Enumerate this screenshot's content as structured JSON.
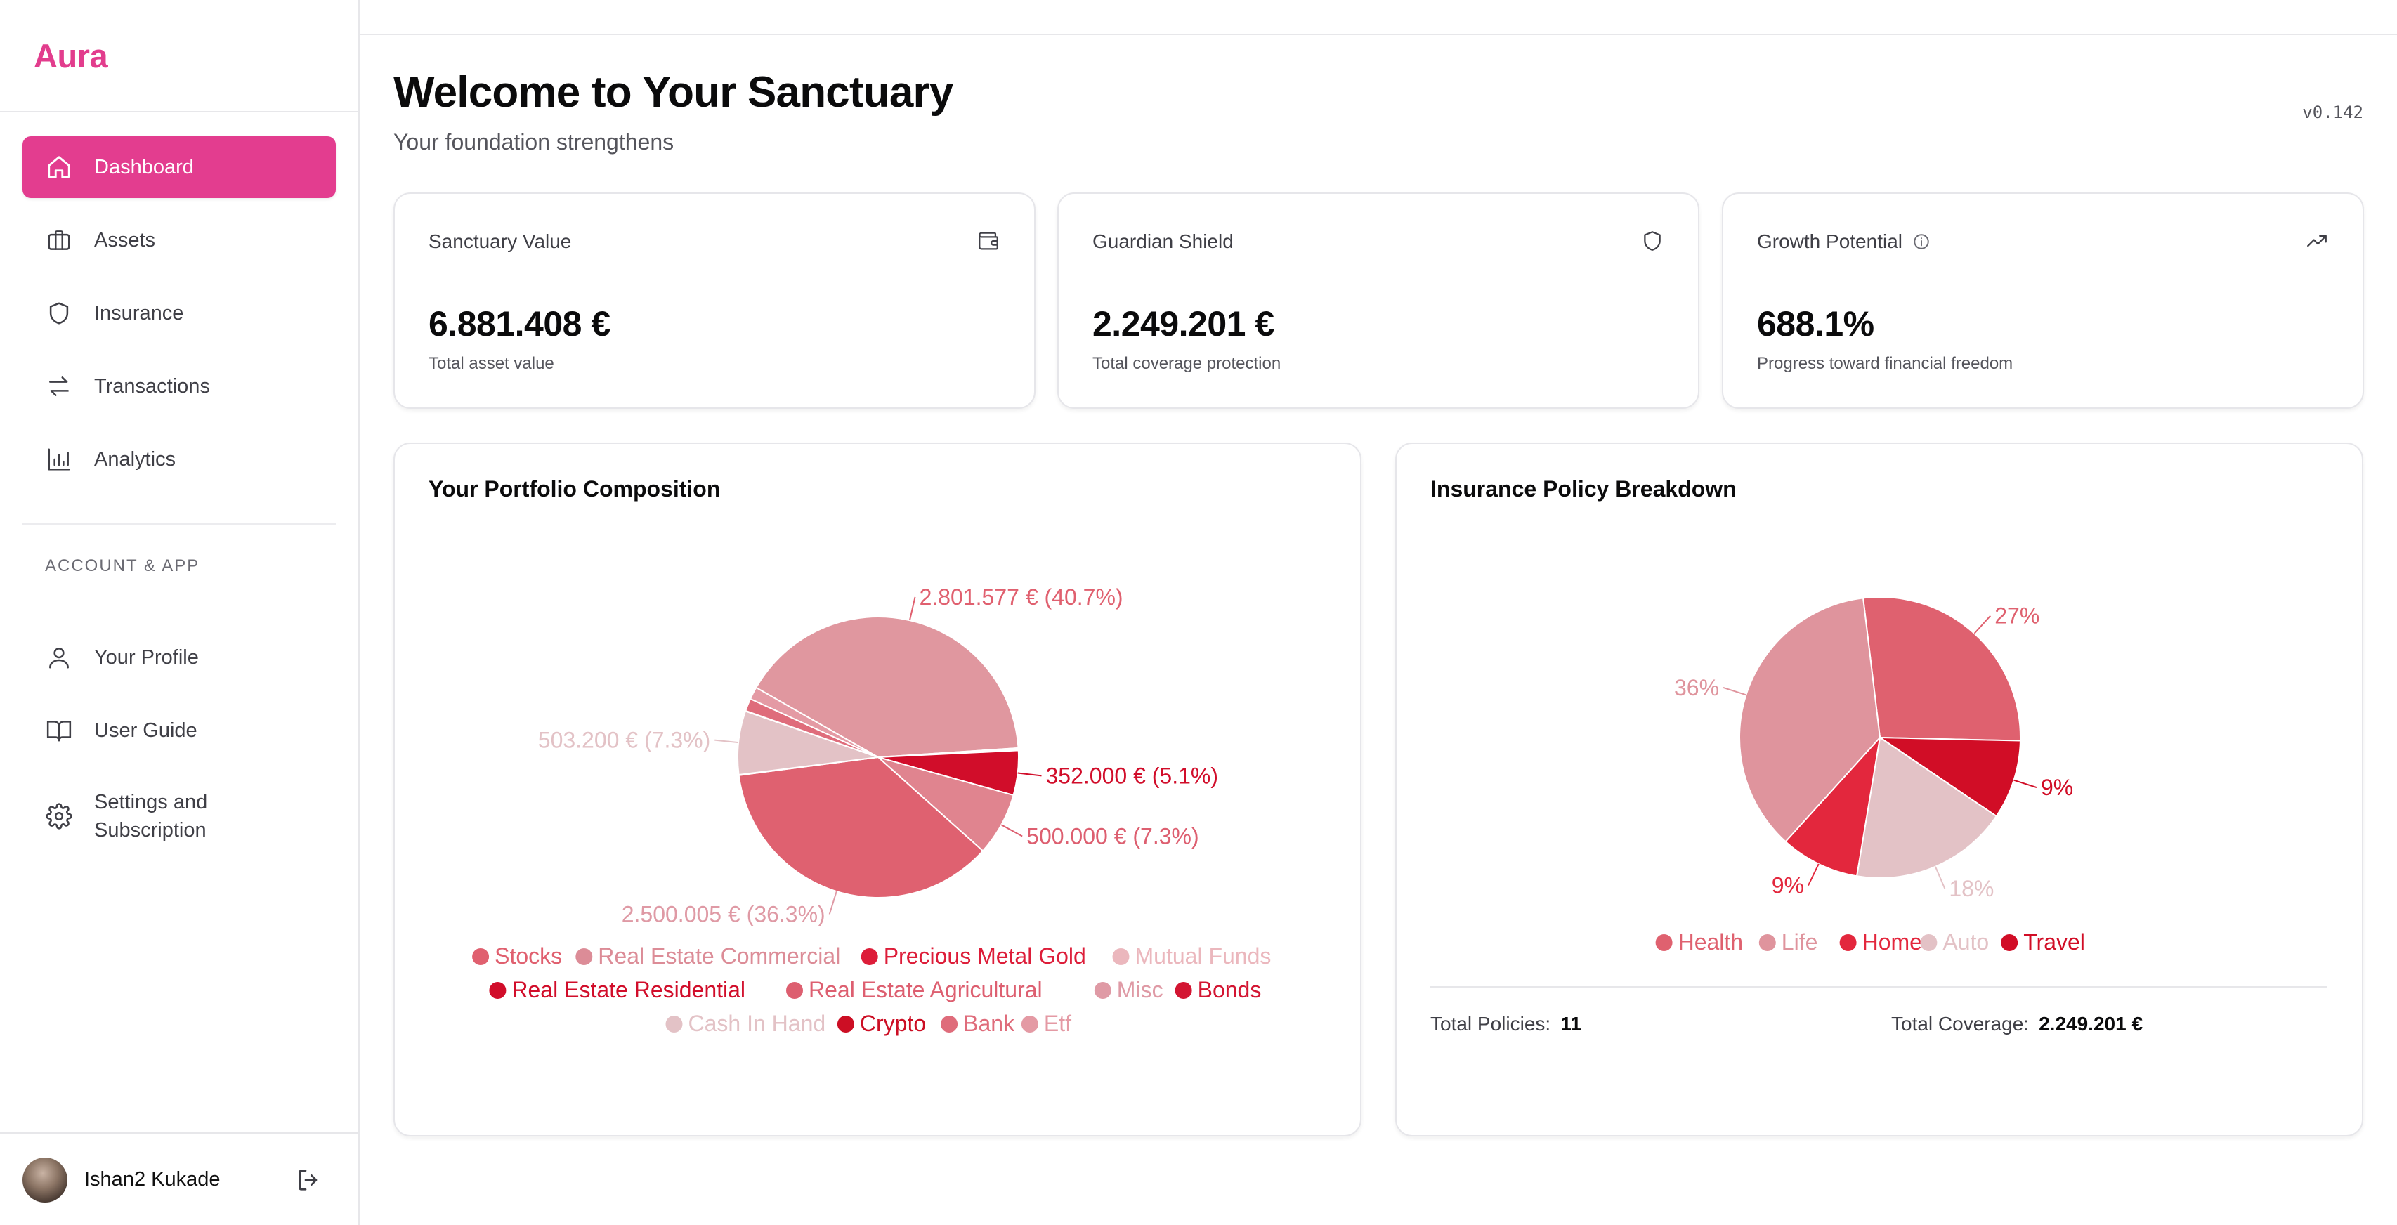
{
  "app": {
    "brand": "Aura",
    "version": "v0.142"
  },
  "sidebar": {
    "nav": [
      {
        "label": "Dashboard",
        "icon": "home-icon",
        "active": true
      },
      {
        "label": "Assets",
        "icon": "briefcase-icon"
      },
      {
        "label": "Insurance",
        "icon": "shield-icon"
      },
      {
        "label": "Transactions",
        "icon": "arrows-swap-icon"
      },
      {
        "label": "Analytics",
        "icon": "bar-chart-icon"
      }
    ],
    "section_label": "ACCOUNT & APP",
    "account": [
      {
        "label": "Your Profile",
        "icon": "user-icon"
      },
      {
        "label": "User Guide",
        "icon": "book-icon"
      },
      {
        "label": "Settings and Subscription",
        "label_line1": "Settings and",
        "label_line2": "Subscription",
        "icon": "gear-icon"
      }
    ],
    "user": {
      "name": "Ishan2 Kukade"
    }
  },
  "header": {
    "title": "Welcome to Your Sanctuary",
    "subtitle": "Your foundation strengthens"
  },
  "stats": [
    {
      "title": "Sanctuary Value",
      "value": "6.881.408 €",
      "note": "Total asset value",
      "icon": "wallet-icon"
    },
    {
      "title": "Guardian Shield",
      "value": "2.249.201 €",
      "note": "Total coverage protection",
      "icon": "shield-icon"
    },
    {
      "title": "Growth Potential",
      "value": "688.1%",
      "note": "Progress toward financial freedom",
      "icon": "trending-up-icon",
      "info_icon": "info-icon"
    }
  ],
  "portfolio": {
    "title": "Your Portfolio Composition",
    "chart_data": {
      "type": "pie",
      "labels": [
        "Stocks",
        "Real Estate Commercial",
        "Precious Metal Gold",
        "Mutual Funds",
        "Real Estate Residential",
        "Real Estate Agricultural",
        "Misc",
        "Bonds",
        "Cash In Hand",
        "Crypto",
        "Bank",
        "Etf"
      ],
      "values": [
        2801577,
        8000,
        6000,
        5000,
        352000,
        500000,
        2500005,
        4000,
        503200,
        3000,
        100000,
        98626
      ],
      "data_labels": {
        "Stocks": "2.801.577 € (40.7%)",
        "Real Estate Residential": "352.000 € (5.1%)",
        "Real Estate Agricultural": "500.000 € (7.3%)",
        "Misc": "2.500.005 € (36.3%)",
        "Cash In Hand": "503.200 € (7.3%)"
      },
      "colors": [
        "#e0979f",
        "#dc8c97",
        "#dd3049",
        "#ebb7bd",
        "#d10d2a",
        "#e0848f",
        "#df6170",
        "#d31532",
        "#e3c2c6",
        "#cc0e24",
        "#df6c7b",
        "#e49aa4"
      ],
      "legend_colors": [
        "#e0606f",
        "#dc8c97",
        "#dd1d39",
        "#ebb7bd",
        "#d10d2a",
        "#dd5f70",
        "#df9aa5",
        "#d31532",
        "#e3c2c6",
        "#cc0e24",
        "#df6c7b",
        "#e49aa4"
      ],
      "legend_rows": [
        [
          0,
          1,
          2,
          3
        ],
        [
          4,
          5,
          6,
          7
        ],
        [
          8,
          9,
          10,
          11
        ]
      ]
    }
  },
  "insurance": {
    "title": "Insurance Policy Breakdown",
    "chart_data": {
      "type": "pie",
      "labels": [
        "Health",
        "Travel",
        "Auto",
        "Home",
        "Life"
      ],
      "values": [
        27,
        9,
        18,
        9,
        36
      ],
      "data_labels": [
        "27%",
        "9%",
        "18%",
        "9%",
        "36%"
      ],
      "colors": [
        "#df616f",
        "#d10d26",
        "#e3c2c6",
        "#e3273d",
        "#df949d"
      ],
      "legend_order": [
        0,
        4,
        3,
        2,
        1
      ]
    },
    "totals": {
      "policies_label": "Total Policies:",
      "policies_value": "11",
      "coverage_label": "Total Coverage:",
      "coverage_value": "2.249.201 €"
    }
  }
}
